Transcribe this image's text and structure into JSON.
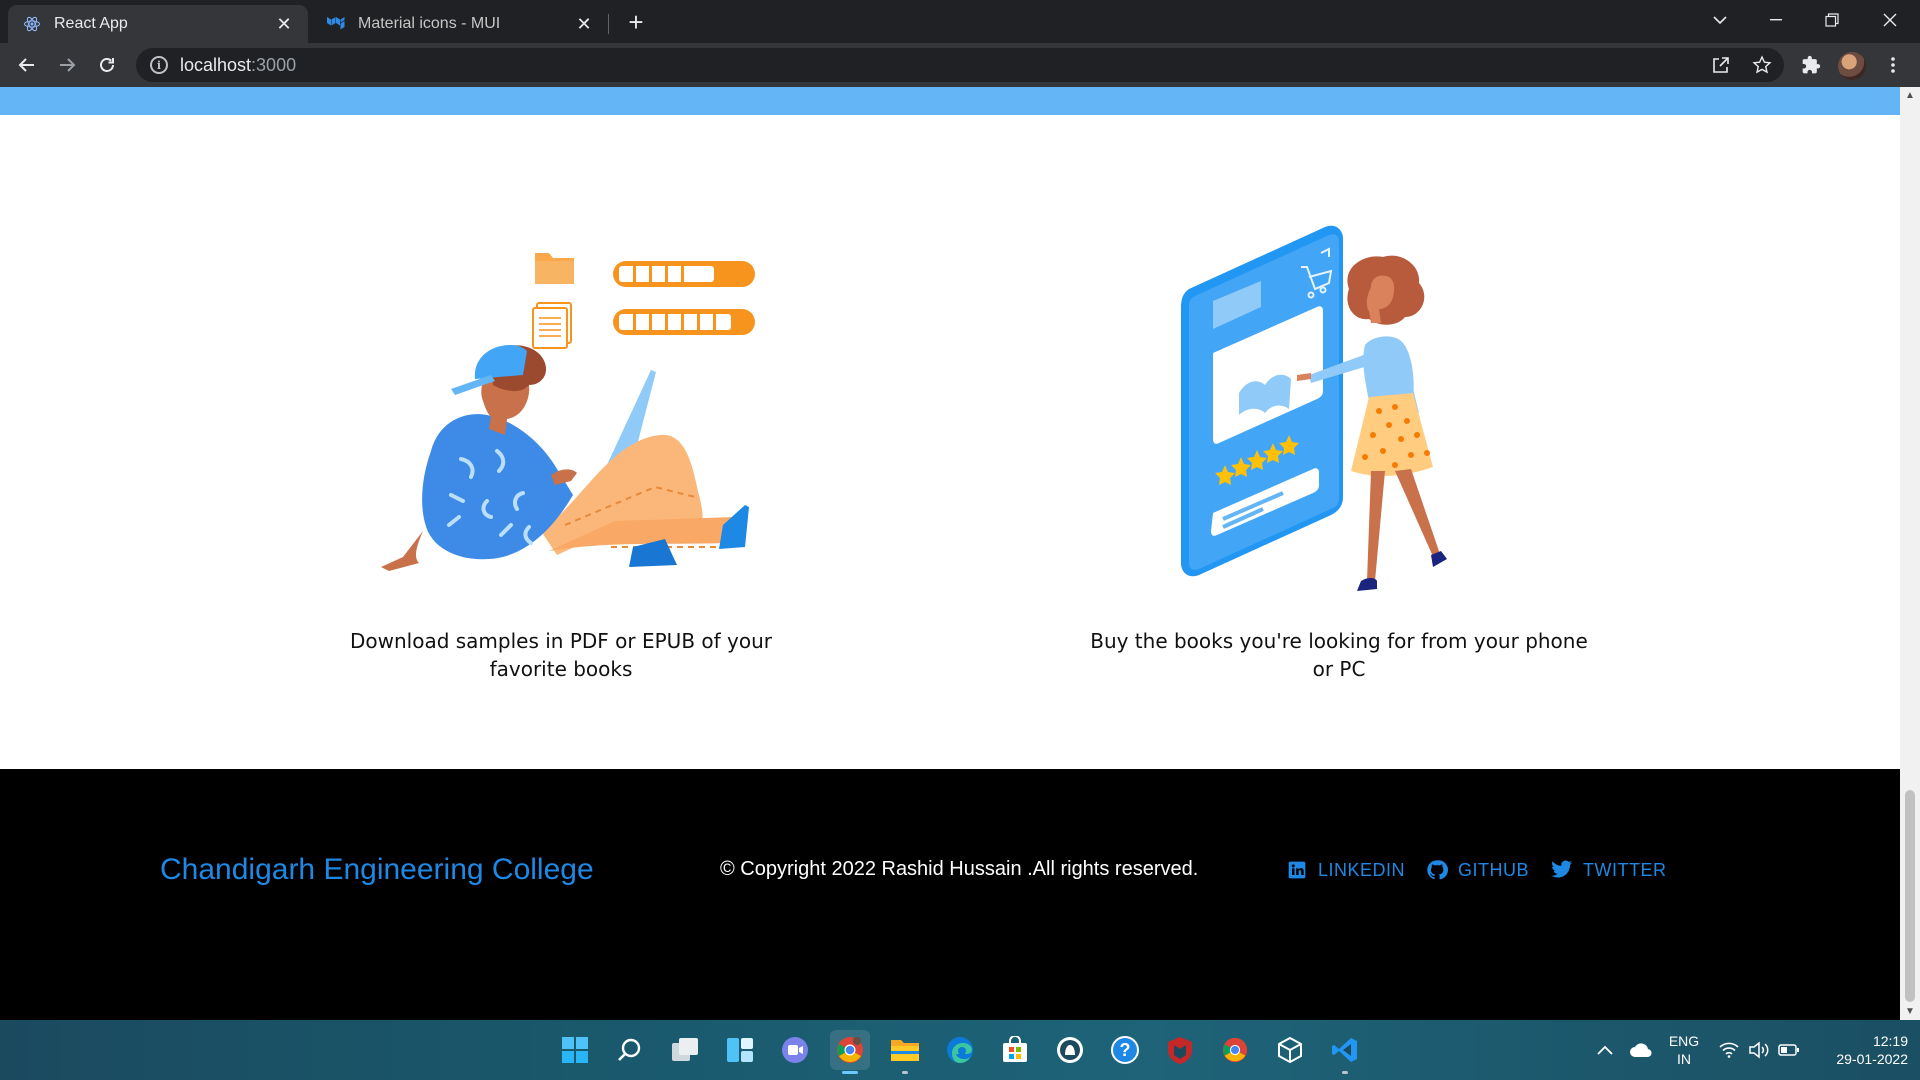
{
  "browser": {
    "tabs": [
      {
        "title": "React App",
        "active": true
      },
      {
        "title": "Material icons - MUI",
        "active": false
      }
    ],
    "address": {
      "host": "localhost",
      "port": ":3000"
    }
  },
  "features": [
    {
      "caption": "Download samples in PDF or EPUB of your favorite books",
      "illustration": "man-reading-laptop"
    },
    {
      "caption": "Buy the books you're looking for from your phone or PC",
      "illustration": "woman-shopping-phone"
    }
  ],
  "footer": {
    "brand": "Chandigarh Engineering College",
    "copyright": "© Copyright 2022 Rashid Hussain .All rights reserved.",
    "links": [
      {
        "label": "LINKEDIN",
        "icon": "linkedin-icon"
      },
      {
        "label": "GITHUB",
        "icon": "github-icon"
      },
      {
        "label": "TWITTER",
        "icon": "twitter-icon"
      }
    ]
  },
  "taskbar": {
    "language": {
      "line1": "ENG",
      "line2": "IN"
    },
    "clock": {
      "time": "12:19",
      "date": "29-01-2022"
    }
  },
  "colors": {
    "accent_blue": "#1e88e5",
    "header_strip": "#64b5f6",
    "footer_bg": "#000000"
  }
}
